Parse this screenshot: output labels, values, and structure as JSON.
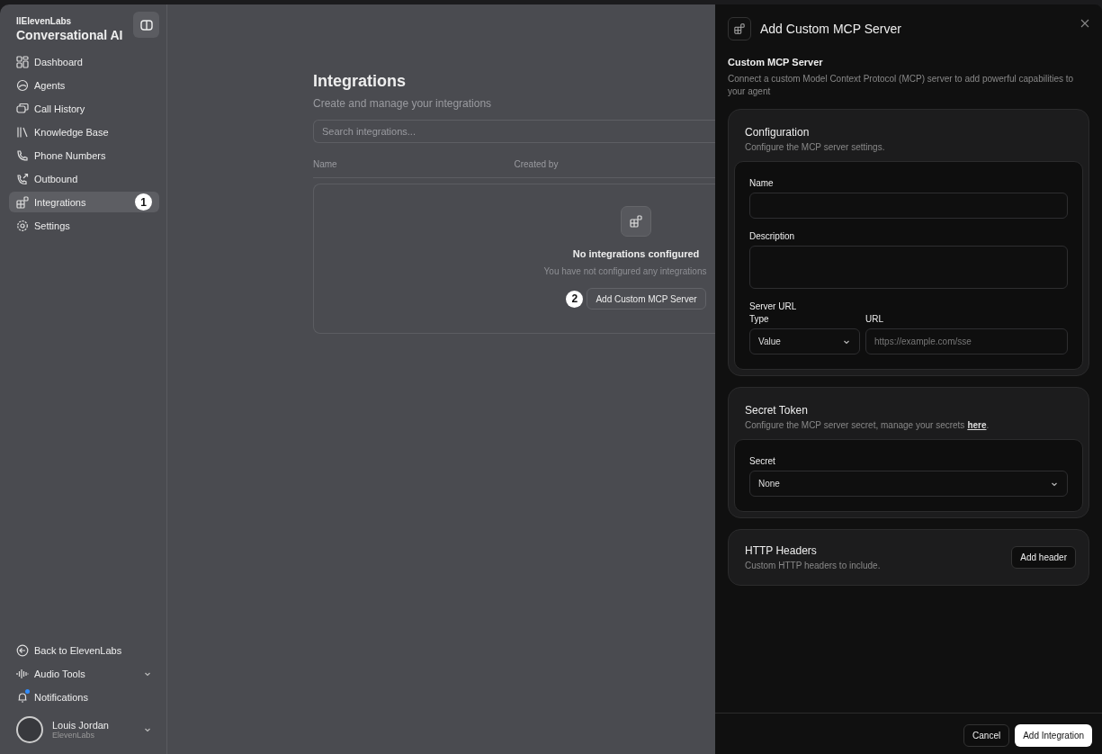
{
  "sidebar": {
    "brand": "IIElevenLabs",
    "title": "Conversational AI",
    "items": [
      {
        "label": "Dashboard",
        "selected": false
      },
      {
        "label": "Agents",
        "selected": false
      },
      {
        "label": "Call History",
        "selected": false
      },
      {
        "label": "Knowledge Base",
        "selected": false
      },
      {
        "label": "Phone Numbers",
        "selected": false
      },
      {
        "label": "Outbound",
        "selected": false
      },
      {
        "label": "Integrations",
        "selected": true,
        "annotation": "1"
      },
      {
        "label": "Settings",
        "selected": false
      }
    ],
    "footer_items": [
      {
        "label": "Back to ElevenLabs",
        "expandable": false,
        "unread": false
      },
      {
        "label": "Audio Tools",
        "expandable": true,
        "unread": false
      },
      {
        "label": "Notifications",
        "expandable": false,
        "unread": true
      }
    ],
    "user": {
      "name": "Louis Jordan",
      "org": "ElevenLabs"
    }
  },
  "main": {
    "title": "Integrations",
    "subtitle": "Create and manage your integrations",
    "search": {
      "placeholder": "Search integrations..."
    },
    "columns": [
      "Name",
      "Created by"
    ],
    "empty": {
      "title": "No integrations configured",
      "text": "You have not configured any integrations",
      "button": "Add Custom MCP Server",
      "annotation": "2"
    }
  },
  "panel": {
    "title": "Add Custom MCP Server",
    "heading": "Custom MCP Server",
    "description": "Connect a custom Model Context Protocol (MCP) server to add powerful capabilities to your agent",
    "configuration": {
      "title": "Configuration",
      "subtitle": "Configure the MCP server settings.",
      "name_label": "Name",
      "description_label": "Description",
      "server_url_label": "Server URL",
      "type_label": "Type",
      "type_value": "Value",
      "url_label": "URL",
      "url_placeholder": "https://example.com/sse"
    },
    "secret_token": {
      "title": "Secret Token",
      "subtitle": "Configure the MCP server secret, manage your secrets",
      "link": "here",
      "after_link": ".",
      "secret_label": "Secret",
      "secret_value": "None"
    },
    "http_headers": {
      "title": "HTTP Headers",
      "subtitle": "Custom HTTP headers to include.",
      "button": "Add header"
    },
    "buttons": {
      "cancel": "Cancel",
      "submit": "Add Integration"
    }
  }
}
